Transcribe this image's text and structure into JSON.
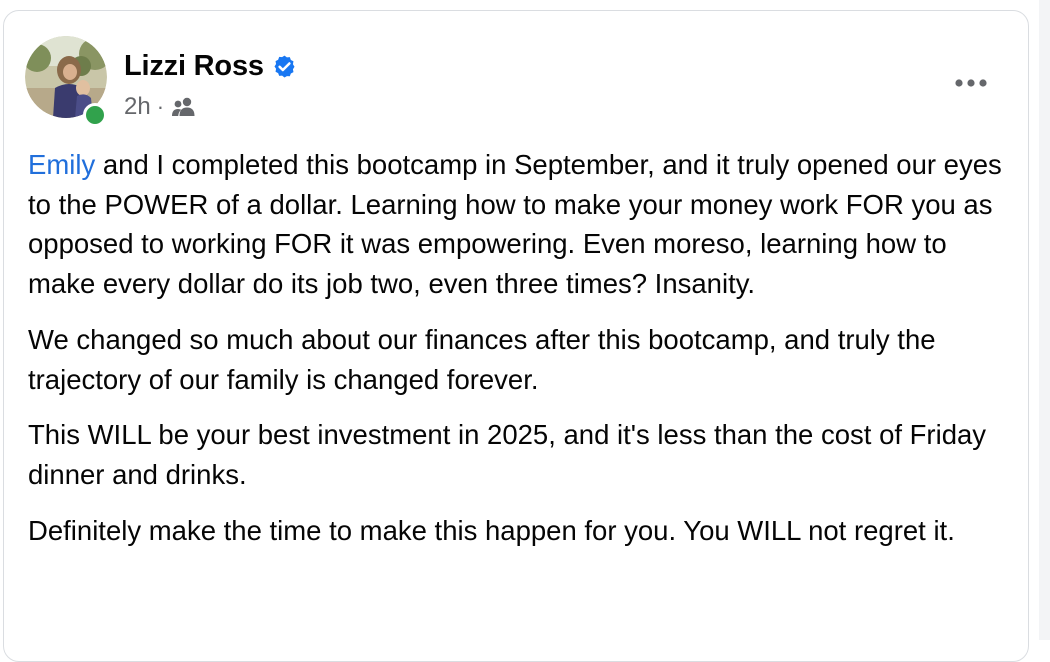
{
  "post": {
    "author": {
      "name": "Lizzi Ross",
      "verified_icon": "verified-badge-icon",
      "online_icon": "online-status-dot",
      "avatar_icon": "profile-photo"
    },
    "meta": {
      "time": "2h",
      "separator": "·",
      "audience_icon": "friends-audience-icon"
    },
    "menu_icon": "more-options-icon",
    "paragraphs": [
      {
        "mention": "Emily",
        "text": " and I completed this bootcamp in September, and it truly opened our eyes to the POWER of a dollar. Learning how to make your money work FOR you as opposed to working FOR it was empowering. Even moreso, learning how to make every dollar do its job two, even three times? Insanity."
      },
      {
        "text": "We changed so much about our finances after this bootcamp, and truly the trajectory of our family is changed forever."
      },
      {
        "text": "This WILL be your best investment in 2025, and it's less than the cost of Friday dinner and drinks."
      },
      {
        "text": "Definitely make the time to make this happen for you. You WILL not regret it."
      }
    ]
  },
  "colors": {
    "text": "#050505",
    "secondary_text": "#65676b",
    "link": "#216fdb",
    "verified": "#1877f2",
    "online": "#31a24c",
    "border": "#dadde1"
  }
}
